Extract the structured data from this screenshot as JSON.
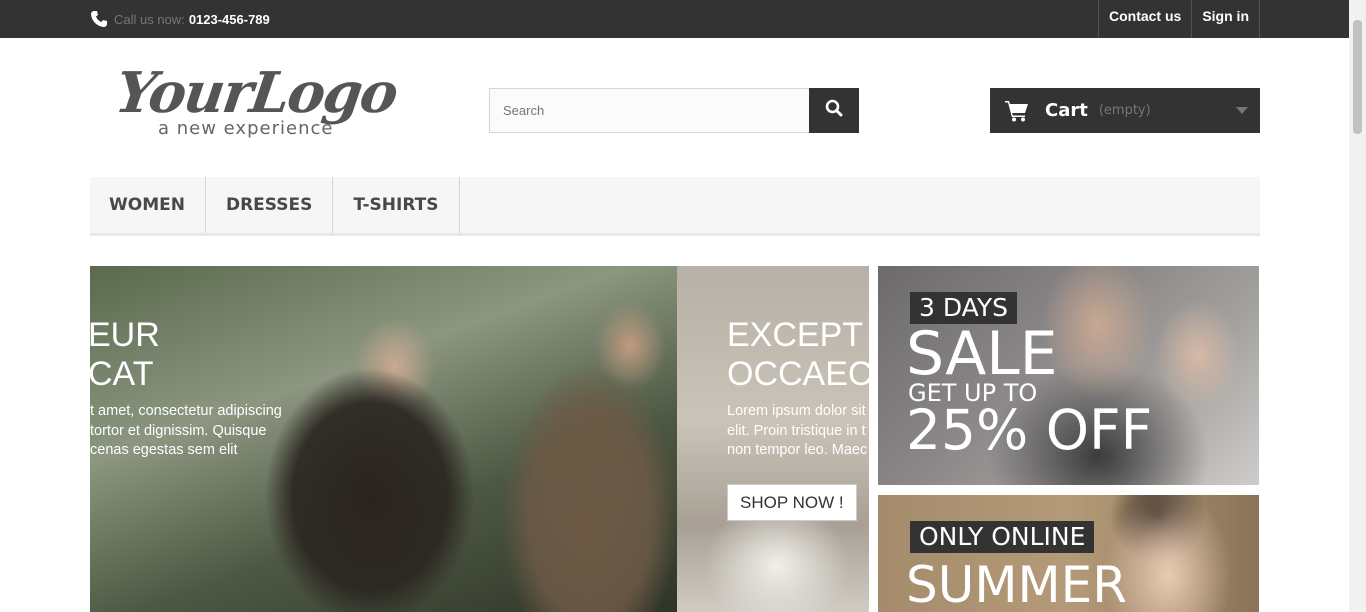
{
  "topbar": {
    "call_label": "Call us now:",
    "phone": "0123-456-789",
    "contact_label": "Contact us",
    "signin_label": "Sign in"
  },
  "logo": {
    "script": "YourLogo",
    "tagline": "a new experience"
  },
  "search": {
    "placeholder": "Search"
  },
  "cart": {
    "label": "Cart",
    "status": "(empty)"
  },
  "menu": {
    "items": [
      {
        "label": "Women"
      },
      {
        "label": "Dresses"
      },
      {
        "label": "T-shirts"
      }
    ]
  },
  "slider": {
    "slide_a": {
      "heading_line1": "EUR",
      "heading_line2": "CAT",
      "body_line1": "t amet, consectetur adipiscing",
      "body_line2": "tortor et dignissim. Quisque",
      "body_line3": "cenas egestas sem elit"
    },
    "slide_b": {
      "heading_line1": "EXCEPT",
      "heading_line2": "OCCAEC",
      "body_line1": "Lorem ipsum dolor sit",
      "body_line2": "elit. Proin tristique in t",
      "body_line3": "non tempor leo. Maec",
      "button_label": "SHOP NOW !"
    }
  },
  "banners": {
    "banner1": {
      "tag": "3 DAYS",
      "big": "SALE",
      "mid": "GET UP TO",
      "huge": "25% OFF"
    },
    "banner2": {
      "tag": "ONLY ONLINE",
      "big": "SUMMER"
    }
  }
}
